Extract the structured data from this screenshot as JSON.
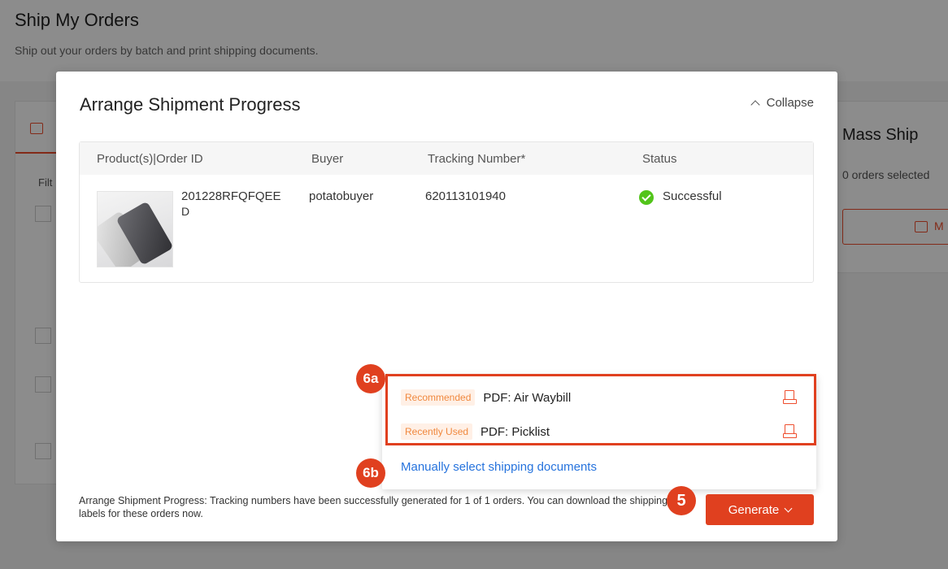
{
  "background": {
    "title": "Ship My Orders",
    "subtitle": "Ship out your orders by batch and print shipping documents.",
    "filter_label": "Filt",
    "mass_ship_title": "Mass Ship",
    "orders_selected": "0 orders selected",
    "mass_ship_button": "M"
  },
  "modal": {
    "title": "Arrange Shipment Progress",
    "collapse_label": "Collapse",
    "table": {
      "headers": [
        "Product(s)|Order ID",
        "Buyer",
        "Tracking Number*",
        "Status"
      ],
      "rows": [
        {
          "order_id": "201228RFQFQEE",
          "order_id_cont": "D",
          "buyer": "potatobuyer",
          "tracking": "620113101940",
          "status": "Successful"
        }
      ]
    },
    "dropdown": {
      "items": [
        {
          "tag": "Recommended",
          "label": "PDF: Air Waybill"
        },
        {
          "tag": "Recently Used",
          "label": "PDF: Picklist"
        }
      ],
      "manual_link": "Manually select shipping documents"
    },
    "footer_text": "Arrange Shipment Progress: Tracking numbers have been successfully generated for 1 of 1 orders. You can download the shipping labels for these orders now.",
    "generate_button": "Generate"
  },
  "annotations": {
    "badge_6a": "6a",
    "badge_6b": "6b",
    "badge_5": "5"
  },
  "colors": {
    "accent": "#ee4d2d",
    "highlight": "#e0401f",
    "link": "#2673dd",
    "success": "#52c41a"
  }
}
